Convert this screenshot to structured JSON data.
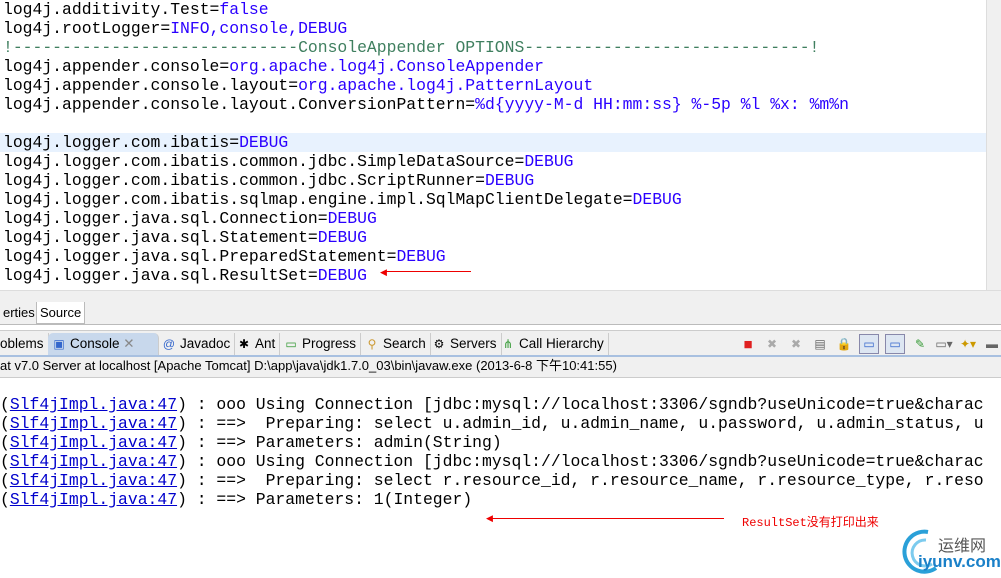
{
  "editor": {
    "lines": [
      {
        "k": "log4j.additivity.Test=",
        "v": "false"
      },
      {
        "k": "log4j.rootLogger=",
        "v": "INFO,console,DEBUG"
      },
      {
        "c": "!-----------------------------ConsoleAppender OPTIONS-----------------------------!"
      },
      {
        "k": "log4j.appender.console=",
        "v": "org.apache.log4j.ConsoleAppender"
      },
      {
        "k": "log4j.appender.console.layout=",
        "v": "org.apache.log4j.PatternLayout"
      },
      {
        "k": "log4j.appender.console.layout.ConversionPattern=",
        "v": "%d{yyyy-M-d HH:mm:ss} %-5p %l %x: %m%n"
      },
      {
        "k": "",
        "v": ""
      },
      {
        "k": "log4j.logger.com.ibatis=",
        "v": "DEBUG"
      },
      {
        "k": "log4j.logger.com.ibatis.common.jdbc.SimpleDataSource=",
        "v": "DEBUG"
      },
      {
        "k": "log4j.logger.com.ibatis.common.jdbc.ScriptRunner=",
        "v": "DEBUG"
      },
      {
        "k": "log4j.logger.com.ibatis.sqlmap.engine.impl.SqlMapClientDelegate=",
        "v": "DEBUG"
      },
      {
        "k": "log4j.logger.java.sql.Connection=",
        "v": "DEBUG"
      },
      {
        "k": "log4j.logger.java.sql.Statement=",
        "v": "DEBUG"
      },
      {
        "k": "log4j.logger.java.sql.PreparedStatement=",
        "v": "DEBUG"
      },
      {
        "k": "log4j.logger.java.sql.ResultSet=",
        "v": "DEBUG"
      }
    ]
  },
  "source_tabs": {
    "properties": "erties",
    "source": "Source"
  },
  "console_tabs": [
    "oblems",
    "Console",
    "Javadoc",
    "Ant",
    "Progress",
    "Search",
    "Servers",
    "Call Hierarchy"
  ],
  "process": "at v7.0 Server at localhost [Apache Tomcat] D:\\app\\java\\jdk1.7.0_03\\bin\\javaw.exe (2013-6-8 下午10:41:55)",
  "console": {
    "lines": [
      {
        "link": "Slf4jImpl.java:47",
        "text": " : ooo Using Connection [jdbc:mysql://localhost:3306/sgndb?useUnicode=true&charac"
      },
      {
        "link": "Slf4jImpl.java:47",
        "text": " : ==>  Preparing: select u.admin_id, u.admin_name, u.password, u.admin_status, u"
      },
      {
        "link": "Slf4jImpl.java:47",
        "text": " : ==> Parameters: admin(String)"
      },
      {
        "link": "Slf4jImpl.java:47",
        "text": " : ooo Using Connection [jdbc:mysql://localhost:3306/sgndb?useUnicode=true&charac"
      },
      {
        "link": "Slf4jImpl.java:47",
        "text": " : ==>  Preparing: select r.resource_id, r.resource_name, r.resource_type, r.reso"
      },
      {
        "link": "Slf4jImpl.java:47",
        "text": " : ==> Parameters: 1(Integer)"
      }
    ]
  },
  "annotation": "ResultSet没有打印出来",
  "watermark": {
    "cn": "运维网",
    "en": "iyunv.com"
  }
}
